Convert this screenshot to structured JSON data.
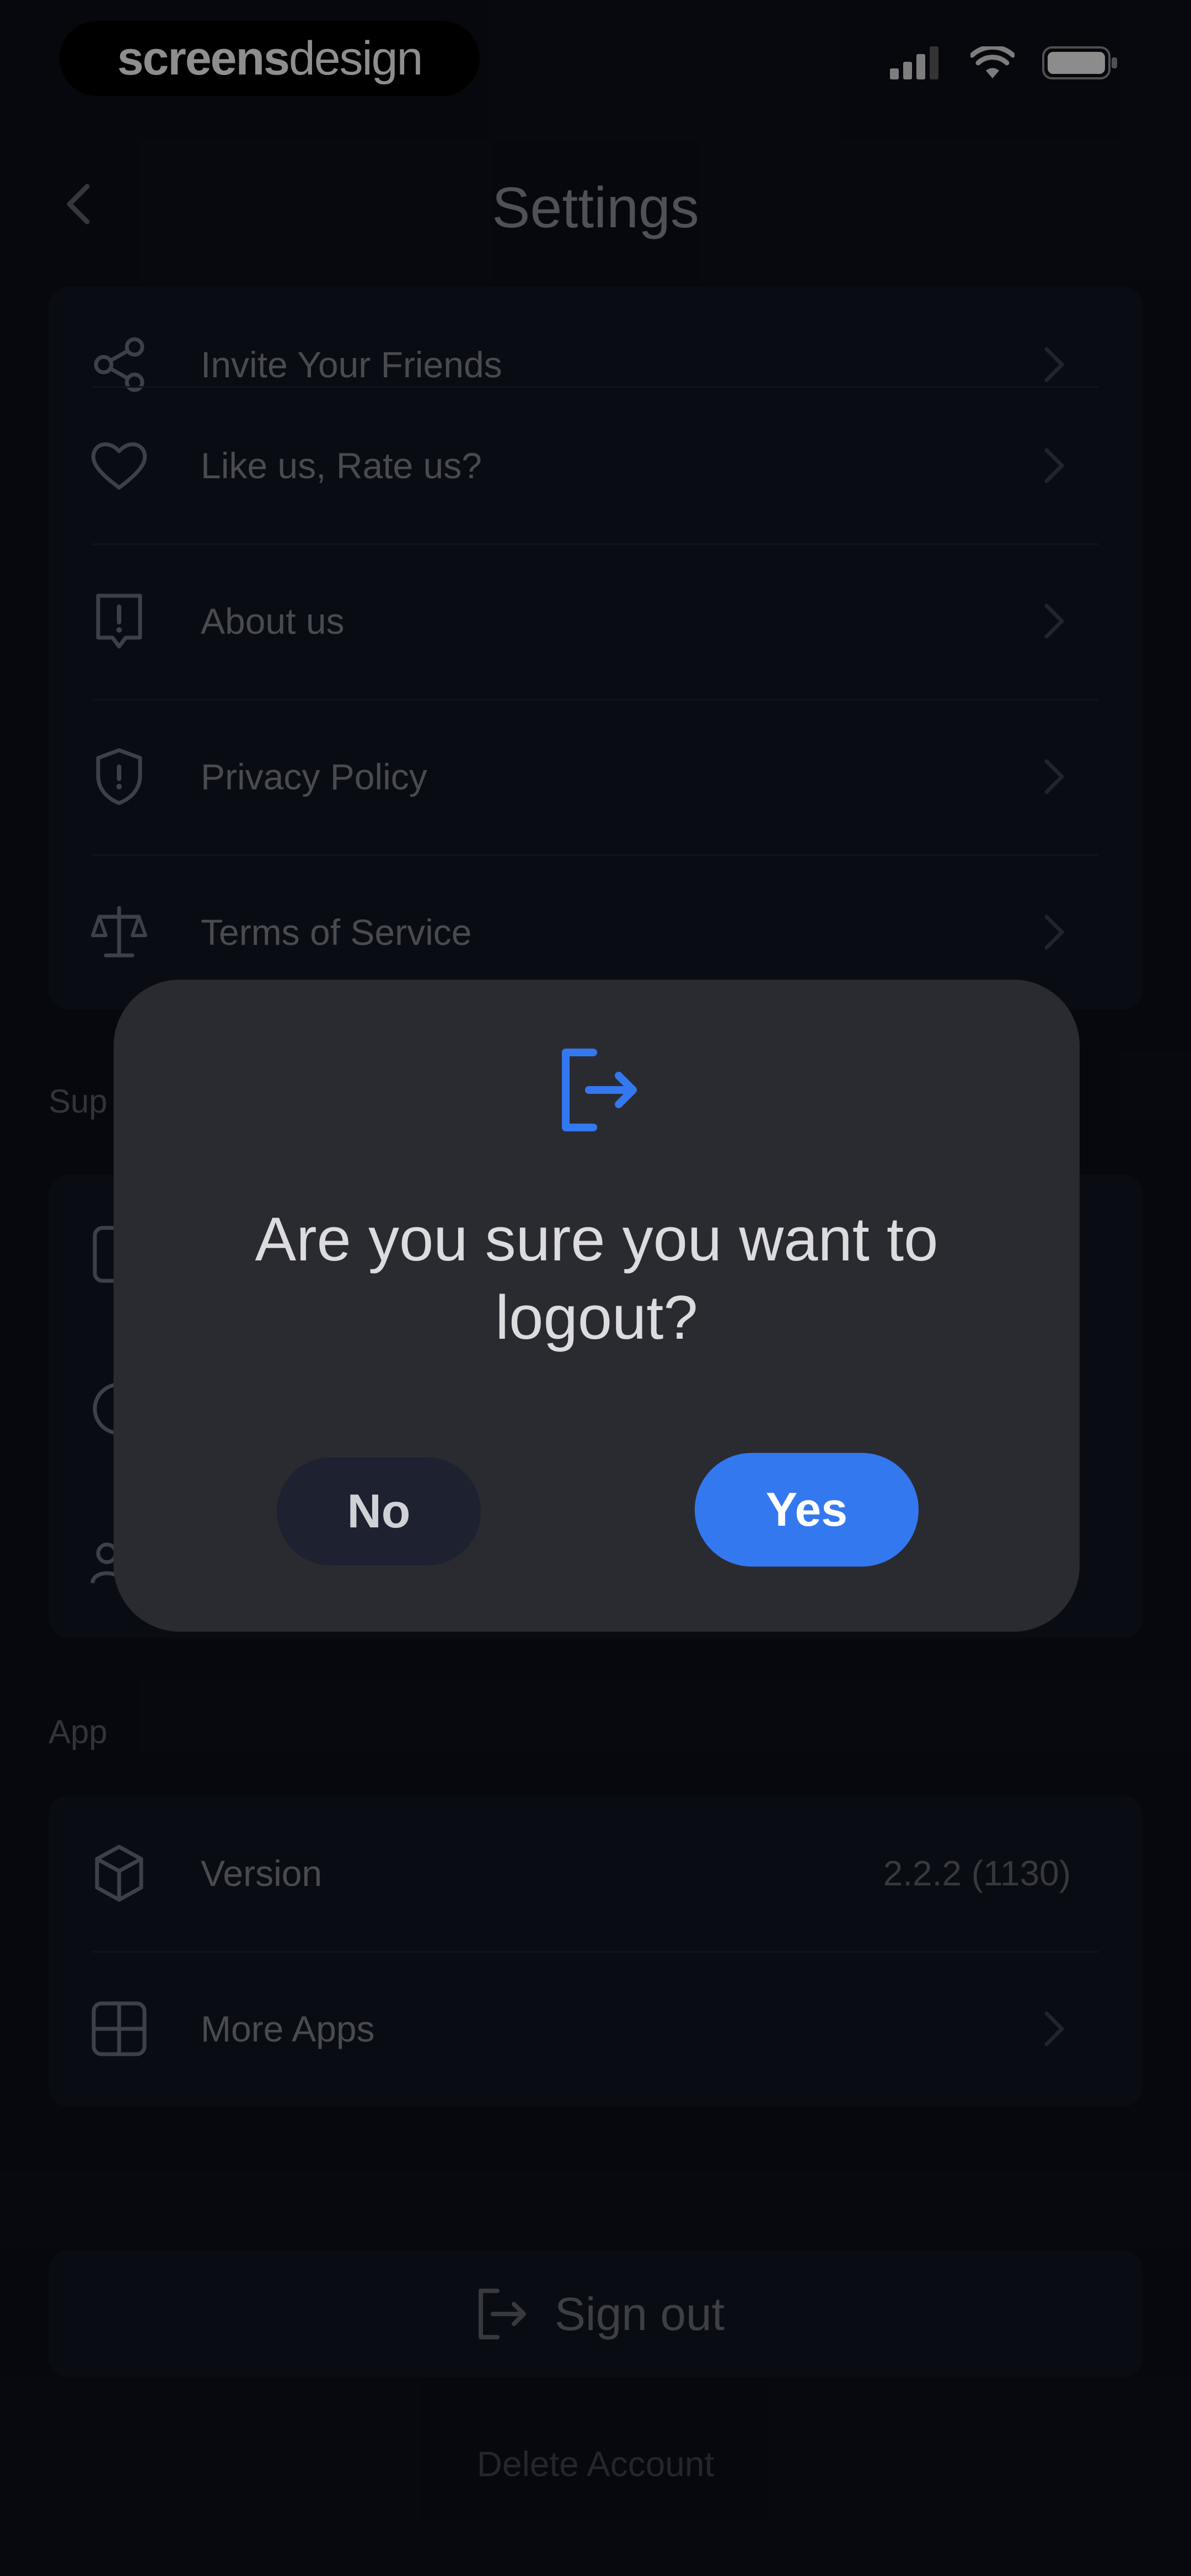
{
  "status_bar": {
    "brand_bold": "screens",
    "brand_light": "design",
    "icons": [
      "signal-icon",
      "wifi-icon",
      "battery-icon"
    ]
  },
  "nav": {
    "title": "Settings",
    "back_icon": "chevron-left-icon"
  },
  "sections": [
    {
      "name": "",
      "items": [
        {
          "label": "Invite Your Friends",
          "icon": "share-icon"
        },
        {
          "label": "Like us, Rate us?",
          "icon": "heart-icon"
        },
        {
          "label": "About us",
          "icon": "info-badge-icon"
        },
        {
          "label": "Privacy Policy",
          "icon": "shield-icon"
        },
        {
          "label": "Terms of Service",
          "icon": "scale-icon"
        }
      ]
    },
    {
      "name": "App",
      "items": [
        {
          "label": "Version",
          "icon": "cube-icon",
          "value": "2.2.2 (1130)"
        },
        {
          "label": "More Apps",
          "icon": "grid-icon"
        }
      ]
    }
  ],
  "partial_section_label": "Sup",
  "sign_out": {
    "label": "Sign out",
    "icon": "logout-icon"
  },
  "delete_account": "Delete Account",
  "dialog": {
    "icon": "logout-icon",
    "message": "Are you sure you want to logout?",
    "no_label": "No",
    "yes_label": "Yes"
  },
  "colors": {
    "background": "#0d0f18",
    "card": "#121522",
    "dialog": "#2a2b31",
    "accent": "#3478f0"
  }
}
